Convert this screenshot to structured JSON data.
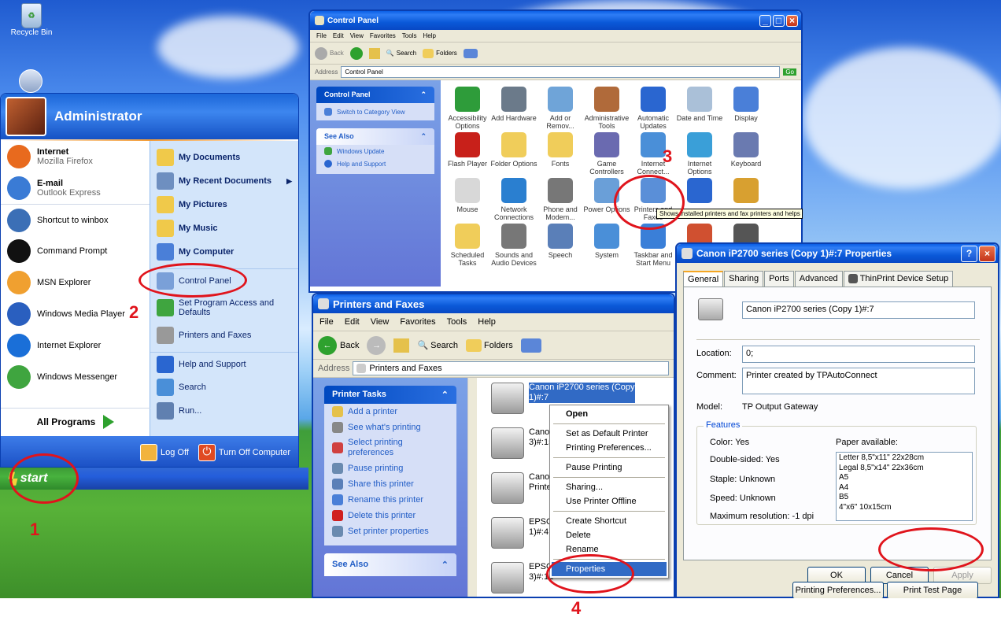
{
  "desktop": {
    "recycle_bin": "Recycle Bin",
    "colors": {
      "xp_blue": "#0a5fe6",
      "start_green": "#3c9a35",
      "annotation_red": "#e0141c"
    }
  },
  "start_menu": {
    "user": "Administrator",
    "left_items": [
      {
        "title": "Internet",
        "subtitle": "Mozilla Firefox",
        "icon": "firefox-icon"
      },
      {
        "title": "E-mail",
        "subtitle": "Outlook Express",
        "icon": "outlook-icon"
      },
      {
        "title": "Shortcut to winbox",
        "subtitle": "",
        "icon": "winbox-icon"
      },
      {
        "title": "Command Prompt",
        "subtitle": "",
        "icon": "cmd-icon"
      },
      {
        "title": "MSN Explorer",
        "subtitle": "",
        "icon": "msn-icon"
      },
      {
        "title": "Windows Media Player",
        "subtitle": "",
        "icon": "media-player-icon"
      },
      {
        "title": "Internet Explorer",
        "subtitle": "",
        "icon": "ie-icon"
      },
      {
        "title": "Windows Messenger",
        "subtitle": "",
        "icon": "messenger-icon"
      }
    ],
    "all_programs": "All Programs",
    "right_items": [
      {
        "label": "My Documents",
        "bold": true
      },
      {
        "label": "My Recent Documents",
        "bold": true
      },
      {
        "label": "My Pictures",
        "bold": true
      },
      {
        "label": "My Music",
        "bold": true
      },
      {
        "label": "My Computer",
        "bold": true
      },
      {
        "label": "Control Panel",
        "bold": false
      },
      {
        "label": "Set Program Access and Defaults",
        "bold": false
      },
      {
        "label": "Printers and Faxes",
        "bold": false
      },
      {
        "label": "Help and Support",
        "bold": false
      },
      {
        "label": "Search",
        "bold": false
      },
      {
        "label": "Run...",
        "bold": false
      }
    ],
    "log_off": "Log Off",
    "turn_off": "Turn Off Computer",
    "start": "start"
  },
  "control_panel": {
    "title": "Control Panel",
    "menu": [
      "File",
      "Edit",
      "View",
      "Favorites",
      "Tools",
      "Help"
    ],
    "back": "Back",
    "search": "Search",
    "folders": "Folders",
    "address_label": "Address",
    "address": "Control Panel",
    "go": "Go",
    "task_title": "Control Panel",
    "switch_view": "Switch to Category View",
    "see_also": "See Also",
    "see_also_items": [
      "Windows Update",
      "Help and Support"
    ],
    "icons": [
      "Accessibility Options",
      "Add Hardware",
      "Add or Remov...",
      "Administrative Tools",
      "Automatic Updates",
      "Date and Time",
      "Display",
      "Flash Player",
      "Folder Options",
      "Fonts",
      "Game Controllers",
      "Internet Connect...",
      "Internet Options",
      "Keyboard",
      "Mouse",
      "Network Connections",
      "Phone and Modem...",
      "Power Options",
      "Printers and Faxes",
      "",
      "",
      "Scheduled Tasks",
      "Sounds and Audio Devices",
      "Speech",
      "System",
      "Taskbar and Start Menu",
      "",
      ""
    ],
    "tooltip": "Shows installed printers and fax printers and helps"
  },
  "printers": {
    "title": "Printers and Faxes",
    "menu": [
      "File",
      "Edit",
      "View",
      "Favorites",
      "Tools",
      "Help"
    ],
    "back": "Back",
    "search": "Search",
    "folders": "Folders",
    "address_label": "Address",
    "address": "Printers and Faxes",
    "printer_tasks": "Printer Tasks",
    "tasks": [
      "Add a printer",
      "See what's printing",
      "Select printing preferences",
      "Pause printing",
      "Share this printer",
      "Rename this printer",
      "Delete this printer",
      "Set printer properties"
    ],
    "see_also": "See Also",
    "printer_list": [
      {
        "line1": "Canon iP2700 series (Copy",
        "line2": "1)#:7"
      },
      {
        "line1": "Canon",
        "line2": "3)#:15"
      },
      {
        "line1": "Canon",
        "line2": "Printer"
      },
      {
        "line1": "EPSON",
        "line2": "1)#:4"
      },
      {
        "line1": "EPSON",
        "line2": "3)#:12"
      }
    ]
  },
  "context_menu": {
    "open": "Open",
    "items1": [
      "Set as Default Printer",
      "Printing Preferences..."
    ],
    "items2": [
      "Pause Printing"
    ],
    "items3": [
      "Sharing...",
      "Use Printer Offline"
    ],
    "items4": [
      "Create Shortcut",
      "Delete",
      "Rename"
    ],
    "properties": "Properties"
  },
  "properties": {
    "title": "Canon iP2700 series (Copy 1)#:7 Properties",
    "tabs": [
      "General",
      "Sharing",
      "Ports",
      "Advanced",
      "ThinPrint Device Setup"
    ],
    "name": "Canon iP2700 series (Copy 1)#:7",
    "location_label": "Location:",
    "location": "0;",
    "comment_label": "Comment:",
    "comment": "Printer created by TPAutoConnect",
    "model_label": "Model:",
    "model": "TP Output Gateway",
    "features": "Features",
    "color": "Color: Yes",
    "double_sided": "Double-sided: Yes",
    "staple": "Staple: Unknown",
    "speed": "Speed: Unknown",
    "max_res": "Maximum resolution: -1 dpi",
    "paper_label": "Paper available:",
    "papers": [
      "Letter 8,5\"x11\" 22x28cm",
      "Legal 8,5\"x14\" 22x36cm",
      "A5",
      "A4",
      "B5",
      "4\"x6\" 10x15cm"
    ],
    "printing_prefs": "Printing Preferences...",
    "print_test": "Print Test Page",
    "ok": "OK",
    "cancel": "Cancel",
    "apply": "Apply"
  },
  "annotations": [
    "1",
    "2",
    "3",
    "4"
  ]
}
